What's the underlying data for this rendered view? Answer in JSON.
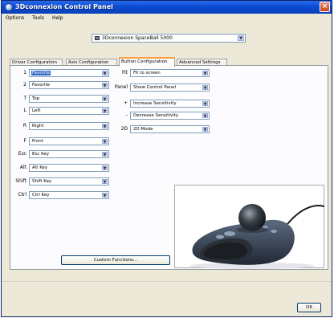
{
  "window": {
    "title": "3Dconnexion Control Panel",
    "close_label": "×"
  },
  "menu": [
    "Options",
    "Tools",
    "Help"
  ],
  "device": {
    "value": "3Dconnexion SpaceBall 5000"
  },
  "tabs": [
    {
      "label": "Driver Configuration",
      "active": false
    },
    {
      "label": "Axis Configuration",
      "active": false
    },
    {
      "label": "Button Configuration",
      "active": true
    },
    {
      "label": "Advanced Settings",
      "active": false
    }
  ],
  "left_buttons": [
    {
      "label": "1",
      "value": "Favorite",
      "highlight": true
    },
    {
      "label": "2",
      "value": "Favorite",
      "highlight": false
    },
    {
      "label": "T",
      "value": "Top",
      "highlight": false
    },
    {
      "label": "L",
      "value": "Left",
      "highlight": false
    },
    {
      "label": "R",
      "value": "Right",
      "highlight": false
    },
    {
      "label": "F",
      "value": "Front",
      "highlight": false
    },
    {
      "label": "Esc",
      "value": "Esc Key",
      "highlight": false
    },
    {
      "label": "Alt",
      "value": "Alt Key",
      "highlight": false
    },
    {
      "label": "Shift",
      "value": "Shift Key",
      "highlight": false
    },
    {
      "label": "Ctrl",
      "value": "Ctrl Key",
      "highlight": false
    }
  ],
  "right_buttons": [
    {
      "label": "Fit",
      "value": "Fit to screen"
    },
    {
      "label": "Panel",
      "value": "Show Control Panel"
    },
    {
      "label": "+",
      "value": "Increase Sensitivity"
    },
    {
      "label": "-",
      "value": "Decrease Sensitivity"
    },
    {
      "label": "2D",
      "value": "2D Mode"
    }
  ],
  "custom_button_label": "Custom Functions...",
  "ok_label": "OK",
  "colors": {
    "title_bar": "#0a4cd4",
    "active_tab_accent": "#ff9d3d",
    "highlight": "#316ac5"
  }
}
